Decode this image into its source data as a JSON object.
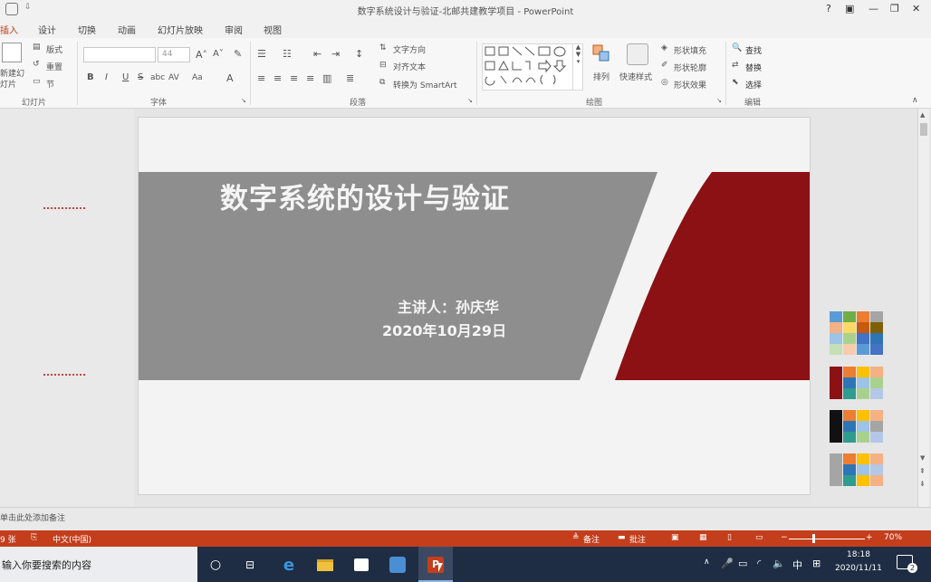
{
  "window": {
    "title": "数字系统设计与验证-北邮共建教学项目 - PowerPoint",
    "help": "?",
    "minimize": "—",
    "restore": "❐",
    "close": "✕"
  },
  "tabs": [
    "插入",
    "设计",
    "切换",
    "动画",
    "幻灯片放映",
    "审阅",
    "视图"
  ],
  "ribbon": {
    "slides": {
      "new_slide": "新建幻灯片",
      "layout": "版式",
      "reset": "重置",
      "section": "节",
      "group": "幻灯片"
    },
    "font": {
      "font_size": "44",
      "bold": "B",
      "italic": "I",
      "underline": "U",
      "strike": "S",
      "shadow": "abc",
      "spacing": "AV",
      "case": "Aa",
      "color": "A",
      "group": "字体"
    },
    "paragraph": {
      "text_direction": "文字方向",
      "align_text": "对齐文本",
      "smartart": "转换为 SmartArt",
      "group": "段落"
    },
    "drawing": {
      "arrange": "排列",
      "quick_styles": "快速样式",
      "fill": "形状填充",
      "outline": "形状轮廓",
      "effects": "形状效果",
      "group": "绘图"
    },
    "editing": {
      "find": "查找",
      "replace": "替换",
      "select": "选择",
      "group": "编辑"
    }
  },
  "slide": {
    "title": "数字系统的设计与验证",
    "presenter": "主讲人：孙庆华",
    "date": "2020年10月29日",
    "gray_band_color": "#8e8e8e",
    "red_band_color": "#8b1114"
  },
  "notes": {
    "placeholder": "单击此处添加备注"
  },
  "status": {
    "slide_count": "9 张",
    "language": "中文(中国)",
    "notes": "备注",
    "comments": "批注",
    "zoom": "70%"
  },
  "taskbar": {
    "search_placeholder": "输入你要搜索的内容",
    "time": "18:18",
    "date": "2020/11/11",
    "ime": "中",
    "notifications": "2"
  },
  "palette": [
    [
      "#5b9bd5",
      "#70ad47",
      "#ed7d31",
      "#a5a5a5"
    ],
    [
      "#f4b183",
      "#ffd966",
      "#c55a11",
      "#7f6000"
    ],
    [
      "#9dc3e6",
      "#a9d18e",
      "#4472c4",
      "#2e75b6"
    ],
    [
      "#c5e0b4",
      "#f8cbad",
      "#5b9bd5",
      "#4472c4"
    ],
    [
      "#8b1114",
      "#ed7d31",
      "#ffc000",
      "#f4b183"
    ],
    [
      "#8b1114",
      "#2e75b6",
      "#9dc3e6",
      "#a9d18e"
    ],
    [
      "#8b1114",
      "#2e9c8f",
      "#a9d18e",
      "#b4c7e7"
    ],
    [
      "#111111",
      "#ed7d31",
      "#ffc000",
      "#f4b183"
    ],
    [
      "#111111",
      "#2e75b6",
      "#9dc3e6",
      "#a5a5a5"
    ],
    [
      "#111111",
      "#2e9c8f",
      "#a9d18e",
      "#b4c7e7"
    ],
    [
      "#a5a5a5",
      "#ed7d31",
      "#ffc000",
      "#f4b183"
    ],
    [
      "#a5a5a5",
      "#2e75b6",
      "#9dc3e6",
      "#b4c7e7"
    ],
    [
      "#a5a5a5",
      "#2e9c8f",
      "#ffc000",
      "#f4b183"
    ]
  ]
}
